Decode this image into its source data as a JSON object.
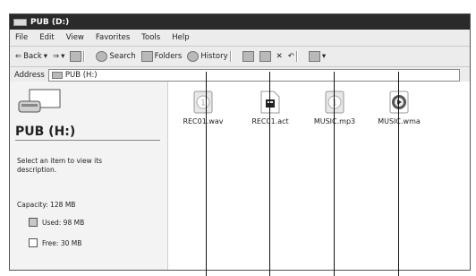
{
  "window": {
    "title": "PUB (D:)"
  },
  "menu": [
    "File",
    "Edit",
    "View",
    "Favorites",
    "Tools",
    "Help"
  ],
  "toolbar": {
    "back": "Back",
    "search": "Search",
    "folders": "Folders",
    "history": "History"
  },
  "address": {
    "label": "Address",
    "value": "PUB (H:)"
  },
  "panel": {
    "drive_name": "PUB (H:)",
    "description": "Select an item to view its description.",
    "capacity": "Capacity: 128 MB",
    "used": "Used: 98 MB",
    "free": "Free: 30 MB"
  },
  "files": [
    {
      "name": "REC01.wav",
      "icon": "wav-file-icon"
    },
    {
      "name": "REC01.act",
      "icon": "act-file-icon"
    },
    {
      "name": "MUSIC.mp3",
      "icon": "mp3-file-icon"
    },
    {
      "name": "MUSIC.wma",
      "icon": "wma-file-icon"
    }
  ]
}
